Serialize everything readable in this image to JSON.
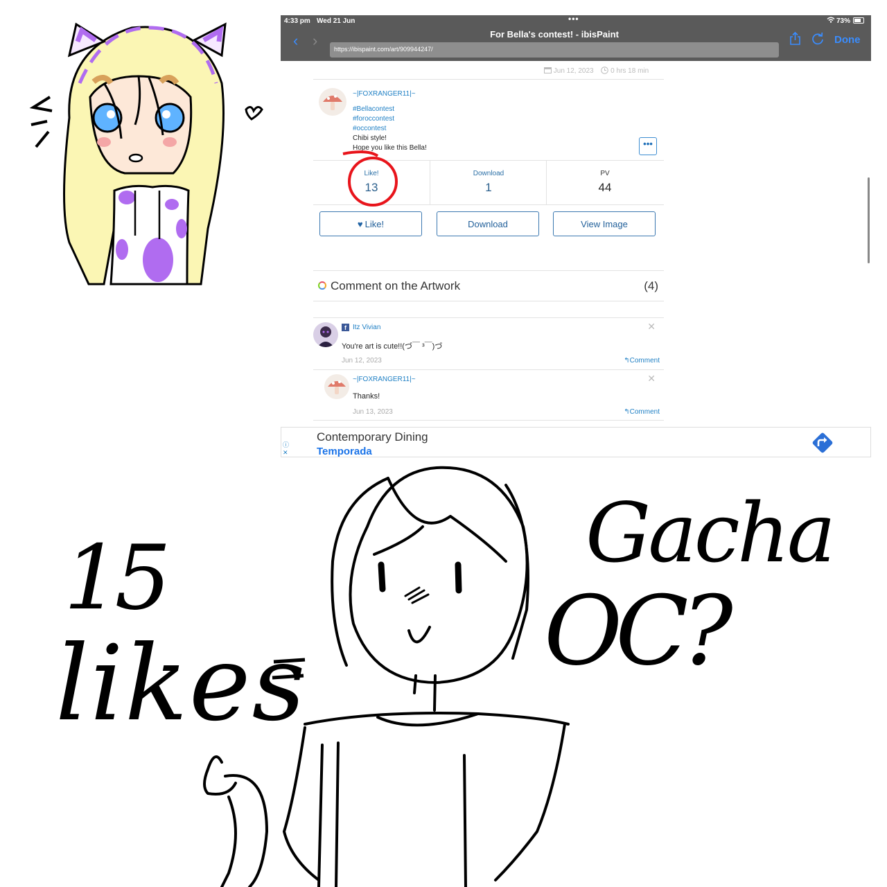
{
  "status_bar": {
    "time": "4:33 pm",
    "date": "Wed 21 Jun",
    "battery": "73%"
  },
  "browser": {
    "title": "For Bella's contest! - ibisPaint",
    "url": "https://ibispaint.com/art/909944247/",
    "done_label": "Done"
  },
  "artwork": {
    "date": "Jun 12, 2023",
    "duration": "0 hrs 18 min",
    "author": "~|FOXRANGER11|~",
    "tags": [
      "#Bellacontest",
      "#foroccontest",
      "#occontest"
    ],
    "description": [
      "Chibi style!",
      "Hope you like this Bella!"
    ],
    "more_label": "•••"
  },
  "stats": {
    "likes_label": "Like!",
    "likes_value": "13",
    "downloads_label": "Download",
    "downloads_value": "1",
    "pv_label": "PV",
    "pv_value": "44"
  },
  "actions": {
    "like": "Like!",
    "download": "Download",
    "view_image": "View Image"
  },
  "comments_section": {
    "title": "Comment on the Artwork",
    "count": "(4)",
    "items": [
      {
        "author": "Itz Vivian",
        "text": "You're art is cute!!(づ￣ ³￣)づ",
        "date": "Jun 12, 2023",
        "reply": "Comment"
      },
      {
        "author": "~|FOXRANGER11|~",
        "text": "Thanks!",
        "date": "Jun 13, 2023",
        "reply": "Comment"
      }
    ]
  },
  "ad": {
    "title": "Contemporary Dining",
    "subtitle": "Temporada"
  },
  "handwriting": {
    "count": "15",
    "word": "likes",
    "question_1": "Gacha",
    "question_2": "OC?"
  },
  "colors": {
    "link_blue": "#1e7fc4",
    "ios_blue": "#3a8dff",
    "topbar_gray": "#5a5a5a",
    "circle_red": "#e8141b",
    "purple": "#b06cf0",
    "hair_yellow": "#fbf6b4"
  },
  "icons": [
    "back-chevron-icon",
    "forward-chevron-icon",
    "share-icon",
    "reload-icon",
    "wifi-icon",
    "battery-icon",
    "calendar-icon",
    "clock-icon",
    "heart-icon",
    "reply-arrow-icon",
    "close-icon",
    "facebook-icon",
    "directions-icon",
    "ad-info-icon",
    "color-ring-icon"
  ]
}
